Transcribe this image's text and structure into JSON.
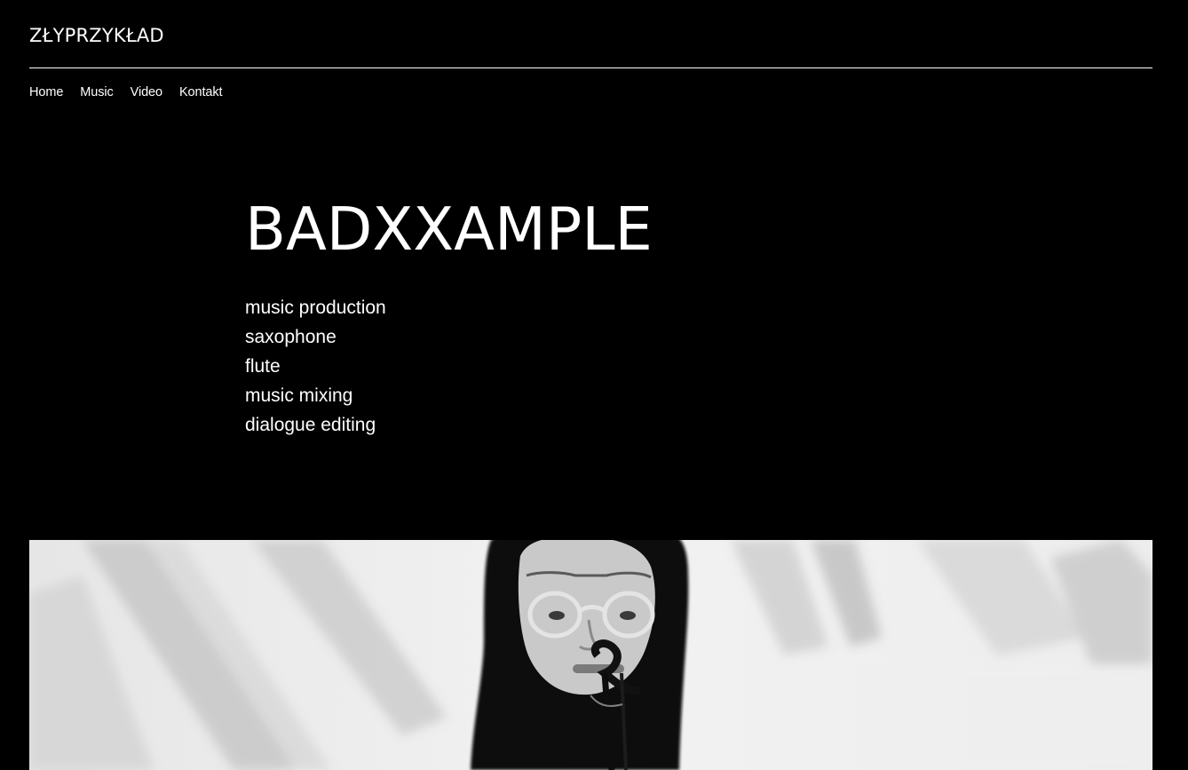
{
  "header": {
    "logo": "ZŁYPRZYKŁAD"
  },
  "nav": {
    "items": [
      {
        "label": "Home"
      },
      {
        "label": "Music"
      },
      {
        "label": "Video"
      },
      {
        "label": "Kontakt"
      }
    ]
  },
  "hero": {
    "title": "BADXXAMPLE",
    "skills": [
      "music production",
      "saxophone",
      "flute",
      "music mixing",
      "dialogue editing"
    ]
  },
  "colors": {
    "background": "#000000",
    "text": "#ffffff",
    "divider": "#ffffff"
  },
  "media": {
    "icon": "person-with-saxophone-photo"
  }
}
